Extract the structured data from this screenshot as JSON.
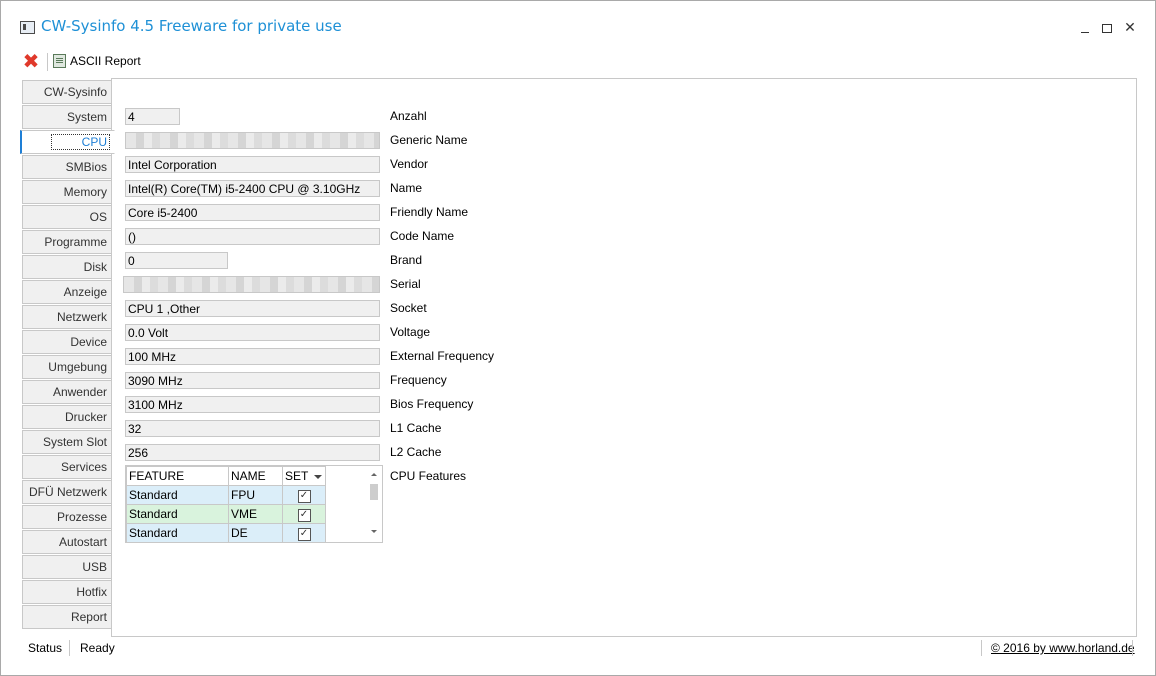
{
  "window": {
    "title": "CW-Sysinfo 4.5 Freeware for private use"
  },
  "toolbar": {
    "close_icon": "red-x-icon",
    "report_label": "ASCII Report"
  },
  "tabs": [
    {
      "label": "CW-Sysinfo"
    },
    {
      "label": "System"
    },
    {
      "label": "CPU",
      "active": true
    },
    {
      "label": "SMBios"
    },
    {
      "label": "Memory"
    },
    {
      "label": "OS"
    },
    {
      "label": "Programme"
    },
    {
      "label": "Disk"
    },
    {
      "label": "Anzeige"
    },
    {
      "label": "Netzwerk"
    },
    {
      "label": "Device"
    },
    {
      "label": "Umgebung"
    },
    {
      "label": "Anwender"
    },
    {
      "label": "Drucker"
    },
    {
      "label": "System Slot"
    },
    {
      "label": "Services"
    },
    {
      "label": "DFÜ Netzwerk"
    },
    {
      "label": "Prozesse"
    },
    {
      "label": "Autostart"
    },
    {
      "label": "USB"
    },
    {
      "label": "Hotfix"
    },
    {
      "label": "Report"
    }
  ],
  "cpu": {
    "fields": [
      {
        "label": "Anzahl",
        "value": "4"
      },
      {
        "label": "Generic Name",
        "value": ""
      },
      {
        "label": "Vendor",
        "value": "Intel Corporation"
      },
      {
        "label": "Name",
        "value": "Intel(R) Core(TM) i5-2400 CPU @ 3.10GHz"
      },
      {
        "label": "Friendly Name",
        "value": "Core i5-2400"
      },
      {
        "label": "Code Name",
        "value": "()"
      },
      {
        "label": "Brand",
        "value": "0"
      },
      {
        "label": "Serial",
        "value": ""
      },
      {
        "label": "Socket",
        "value": "CPU 1 ,Other"
      },
      {
        "label": "Voltage",
        "value": "0.0 Volt"
      },
      {
        "label": "External Frequency",
        "value": "100 MHz"
      },
      {
        "label": "Frequency",
        "value": "3090 MHz"
      },
      {
        "label": "Bios Frequency",
        "value": "3100 MHz"
      },
      {
        "label": "L1 Cache",
        "value": "32"
      },
      {
        "label": "L2 Cache",
        "value": "256"
      }
    ],
    "features_label": "CPU Features",
    "features_grid": {
      "columns": [
        "FEATURE",
        "NAME",
        "SET"
      ],
      "rows": [
        {
          "feature": "Standard",
          "name": "FPU",
          "set": true
        },
        {
          "feature": "Standard",
          "name": "VME",
          "set": true
        },
        {
          "feature": "Standard",
          "name": "DE",
          "set": true
        }
      ]
    }
  },
  "status": {
    "label": "Status",
    "value": "Ready",
    "copyright": "© 2016 by www.horland.de"
  },
  "colors": {
    "title": "#1e90d6",
    "active_tab": "#1e7fd6",
    "close_icon": "#e0392b"
  }
}
